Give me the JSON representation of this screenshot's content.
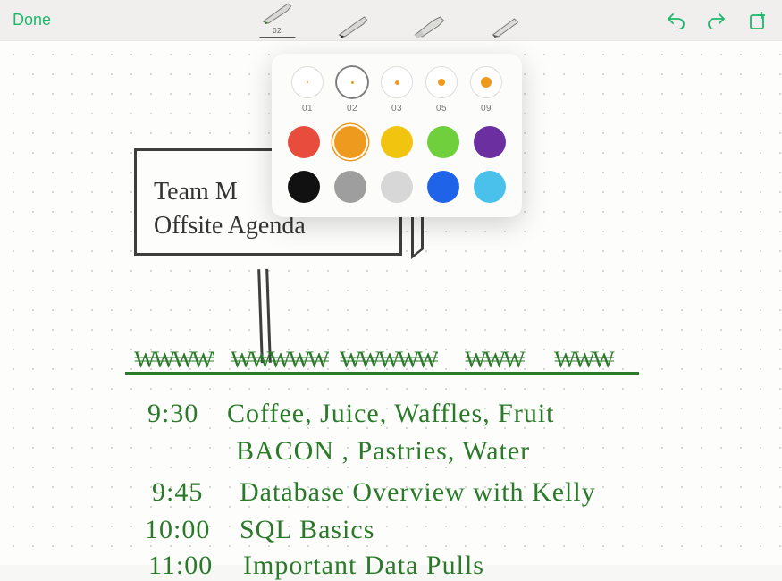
{
  "toolbar": {
    "done_label": "Done",
    "selected_tool_size": "02",
    "tools": [
      {
        "type": "marker-green",
        "size": "02"
      },
      {
        "type": "marker-black"
      },
      {
        "type": "highlighter"
      },
      {
        "type": "pencil"
      }
    ]
  },
  "popover": {
    "thickness": [
      {
        "label": "01",
        "dot": 2,
        "selected": false
      },
      {
        "label": "02",
        "dot": 3,
        "selected": true
      },
      {
        "label": "03",
        "dot": 5,
        "selected": false
      },
      {
        "label": "05",
        "dot": 8,
        "selected": false
      },
      {
        "label": "09",
        "dot": 12,
        "selected": false
      }
    ],
    "colors_row1": [
      {
        "name": "red",
        "hex": "#e74c3c",
        "selected": false
      },
      {
        "name": "orange",
        "hex": "#ee9a1f",
        "selected": true
      },
      {
        "name": "yellow",
        "hex": "#f1c40f",
        "selected": false
      },
      {
        "name": "green",
        "hex": "#6fcf3c",
        "selected": false
      },
      {
        "name": "purple",
        "hex": "#6b2fa0",
        "selected": false
      }
    ],
    "colors_row2": [
      {
        "name": "black",
        "hex": "#111111"
      },
      {
        "name": "gray",
        "hex": "#9e9e9e"
      },
      {
        "name": "lightgray",
        "hex": "#d7d7d7"
      },
      {
        "name": "blue",
        "hex": "#1f63e8"
      },
      {
        "name": "skyblue",
        "hex": "#49c1ea"
      }
    ]
  },
  "sign": {
    "line1": "Team M",
    "line2": "Offsite Agenda"
  },
  "agenda": [
    {
      "time": "9:30",
      "text": "Coffee, Juice, Waffles, Fruit"
    },
    {
      "time": "",
      "text": "BACON ,  Pastries, Water"
    },
    {
      "time": "9:45",
      "text": "Database Overview with Kelly"
    },
    {
      "time": "10:00",
      "text": "SQL Basics"
    },
    {
      "time": "11:00",
      "text": "Important Data Pulls"
    }
  ]
}
